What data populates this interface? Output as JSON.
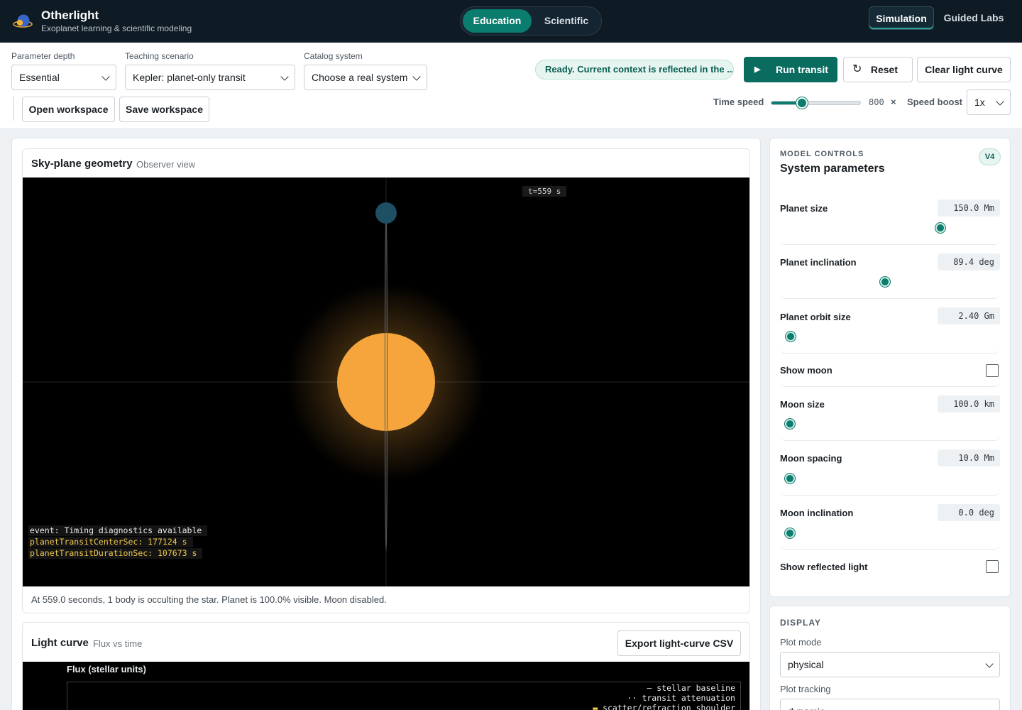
{
  "header": {
    "title": "Otherlight",
    "subtitle": "Exoplanet learning & scientific modeling",
    "modes": [
      {
        "label": "Education",
        "active": true
      },
      {
        "label": "Scientific",
        "active": false
      }
    ],
    "nav": [
      {
        "label": "Simulation",
        "active": true
      },
      {
        "label": "Guided Labs",
        "active": false
      }
    ]
  },
  "toolbar": {
    "parameter_depth": {
      "label": "Parameter depth",
      "value": "Essential"
    },
    "teaching_scenario": {
      "label": "Teaching scenario",
      "value": "Kepler: planet-only transit"
    },
    "catalog_system": {
      "label": "Catalog system",
      "value": "Choose a real system"
    },
    "open_workspace": "Open workspace",
    "save_workspace": "Save workspace",
    "status": "Ready. Current context is reflected in the ...",
    "run_transit": "Run transit",
    "reset": "Reset",
    "clear_light_curve": "Clear light curve",
    "time_speed": {
      "label": "Time speed",
      "value": "800",
      "unit": "×",
      "level_fraction": 0.34
    },
    "speed_boost": {
      "label": "Speed boost",
      "value": "1x"
    }
  },
  "sky": {
    "title": "Sky-plane geometry",
    "subtitle": "Observer view",
    "time_tag": "t=559 s",
    "overlay": {
      "event": "event: Timing diagnostics available",
      "center": "planetTransitCenterSec: 177124 s",
      "duration": "planetTransitDurationSec: 107673 s"
    },
    "caption": "At 559.0 seconds, 1 body is occulting the star. Planet is 100.0% visible. Moon disabled.",
    "colors": {
      "star": "#f5a53c",
      "planet": "#1e4f63",
      "background": "#000000"
    }
  },
  "light_curve": {
    "title": "Light curve",
    "subtitle": "Flux vs time",
    "export": "Export light-curve CSV",
    "ylabel": "Flux (stellar units)",
    "legend": [
      {
        "symbol": "—",
        "label": "stellar baseline",
        "color": "#e9ecef"
      },
      {
        "symbol": "··",
        "label": "transit attenuation",
        "color": "#e9ecef"
      },
      {
        "symbol": "▬",
        "label": "scatter/refraction shoulder",
        "color": "#f0c84a"
      }
    ]
  },
  "controls": {
    "eyebrow": "MODEL CONTROLS",
    "title": "System parameters",
    "version": "V4",
    "params": [
      {
        "name": "Planet size",
        "value": "150.0 Mm",
        "level_fraction": 0.73
      },
      {
        "name": "Planet inclination",
        "value": "89.4 deg",
        "level_fraction": 0.47
      },
      {
        "name": "Planet orbit size",
        "value": "2.40 Gm",
        "level_fraction": 0.025
      },
      {
        "name": "Show moon",
        "checked": false
      },
      {
        "name": "Moon size",
        "value": "100.0 km",
        "level_fraction": 0.022
      },
      {
        "name": "Moon spacing",
        "value": "10.0 Mm",
        "level_fraction": 0.022
      },
      {
        "name": "Moon inclination",
        "value": "0.0 deg",
        "level_fraction": 0.022
      },
      {
        "name": "Show reflected light",
        "checked": false
      }
    ]
  },
  "display": {
    "eyebrow": "DISPLAY",
    "plot_mode": {
      "label": "Plot mode",
      "value": "physical"
    },
    "plot_tracking": {
      "label": "Plot tracking",
      "value": "dynamic"
    }
  },
  "accent_color": "#0a7d6e"
}
